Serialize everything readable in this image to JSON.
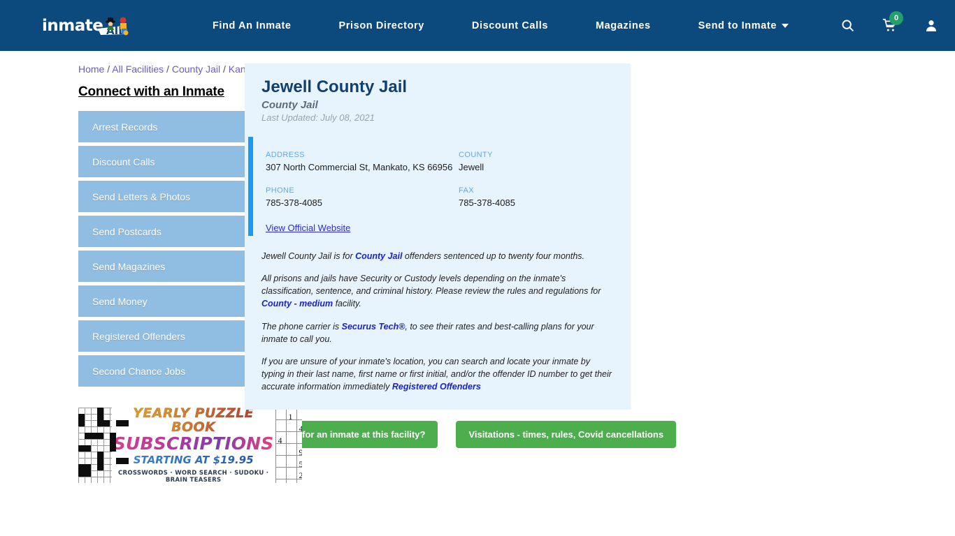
{
  "header": {
    "logo_text": "inmate",
    "logo_aid": "AID",
    "nav": [
      {
        "label": "Find An Inmate",
        "dropdown": false
      },
      {
        "label": "Prison Directory",
        "dropdown": false
      },
      {
        "label": "Discount Calls",
        "dropdown": false
      },
      {
        "label": "Magazines",
        "dropdown": false
      },
      {
        "label": "Send to Inmate",
        "dropdown": true
      }
    ],
    "icons": {
      "search": "search-icon",
      "cart": "shopping-cart-icon",
      "cart_count": "0",
      "account": "user-account-icon"
    },
    "background_color": "#0c497c",
    "badge_color": "#22a06b"
  },
  "breadcrumb": {
    "items": [
      "Home",
      "All Facilities",
      "County Jail",
      "Kansas"
    ],
    "separator": "/"
  },
  "sidebar": {
    "title": "Connect with an Inmate",
    "items": [
      {
        "label": "Arrest Records"
      },
      {
        "label": "Discount Calls"
      },
      {
        "label": "Send Letters & Photos"
      },
      {
        "label": "Send Postcards"
      },
      {
        "label": "Send Magazines"
      },
      {
        "label": "Send Money"
      },
      {
        "label": "Registered Offenders"
      },
      {
        "label": "Second Chance Jobs"
      }
    ]
  },
  "ad": {
    "line1": "YEARLY PUZZLE BOOK",
    "line2": "SUBSCRIPTIONS",
    "line3": "STARTING AT $19.95",
    "line4": "CROSSWORDS · WORD SEARCH · SUDOKU · BRAIN TEASERS",
    "sudoku_digits": [
      "1",
      "4",
      "4",
      "9",
      "5",
      "2"
    ]
  },
  "facility": {
    "name": "Jewell County Jail",
    "type": "County Jail",
    "last_updated": "Last Updated: July 08, 2021",
    "fields": {
      "address_label": "ADDRESS",
      "address_value": "307 North Commercial St, Mankato, KS 66956",
      "county_label": "COUNTY",
      "county_value": "Jewell",
      "phone_label": "PHONE",
      "phone_value": "785-378-4085",
      "fax_label": "FAX",
      "fax_value": "785-378-4085"
    },
    "official_website": "View Official Website",
    "accent_color": "#1b9bf0",
    "card_background": "#e8f4fd"
  },
  "description": {
    "p1_a": "Jewell County Jail is for ",
    "p1_link": "County Jail",
    "p1_b": " offenders sentenced up to twenty four months.",
    "p2_a": "All prisons and jails have Security or Custody levels depending on the inmate's classification, sentence, and criminal history. Please review the rules and regulations for ",
    "p2_link": "County - medium",
    "p2_b": " facility.",
    "p3_a": "The phone carrier is ",
    "p3_link": "Securus Tech®",
    "p3_b": ", to see their rates and best-calling plans for your inmate to call you.",
    "p4_a": "If you are unsure of your inmate's location, you can search and locate your inmate by typing in their last name, first name or first initial, and/or the offender ID number to get their accurate information immediately ",
    "p4_link": "Registered Offenders"
  },
  "actions": {
    "inmate_search": "Looking for an inmate at this facility?",
    "visitations": "Visitations - times, rules, Covid cancellations",
    "color": "#4cae4c"
  }
}
